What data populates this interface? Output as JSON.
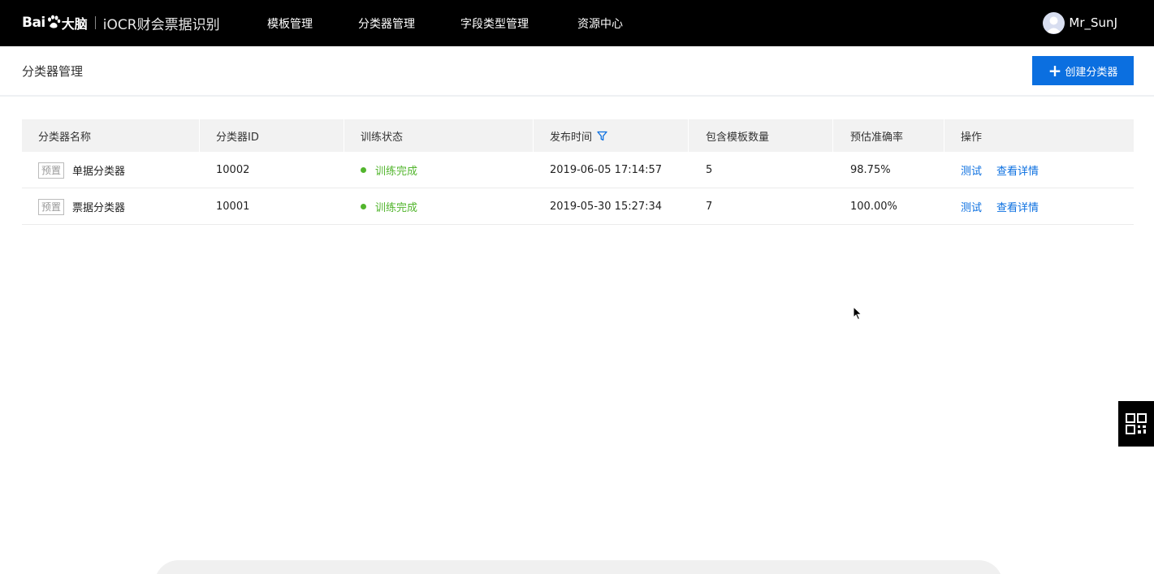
{
  "header": {
    "logo_bai": "Bai",
    "logo_brain": "大脑",
    "product": "iOCR财会票据识别",
    "nav": [
      {
        "label": "模板管理"
      },
      {
        "label": "分类器管理"
      },
      {
        "label": "字段类型管理"
      },
      {
        "label": "资源中心"
      }
    ],
    "user_name": "Mr_SunJ"
  },
  "page": {
    "title": "分类器管理",
    "create_button": "创建分类器"
  },
  "table": {
    "columns": [
      "分类器名称",
      "分类器ID",
      "训练状态",
      "发布时间",
      "包含模板数量",
      "预估准确率",
      "操作"
    ],
    "rows": [
      {
        "tag": "预置",
        "name": "单据分类器",
        "id": "10002",
        "status": "训练完成",
        "published": "2019-06-05 17:14:57",
        "templates": "5",
        "accuracy": "98.75%",
        "action_test": "测试",
        "action_detail": "查看详情"
      },
      {
        "tag": "预置",
        "name": "票据分类器",
        "id": "10001",
        "status": "训练完成",
        "published": "2019-05-30 15:27:34",
        "templates": "7",
        "accuracy": "100.00%",
        "action_test": "测试",
        "action_detail": "查看详情"
      }
    ]
  },
  "colors": {
    "topbar": "#000000",
    "primary": "#0b6fe0",
    "success": "#52b52d"
  }
}
